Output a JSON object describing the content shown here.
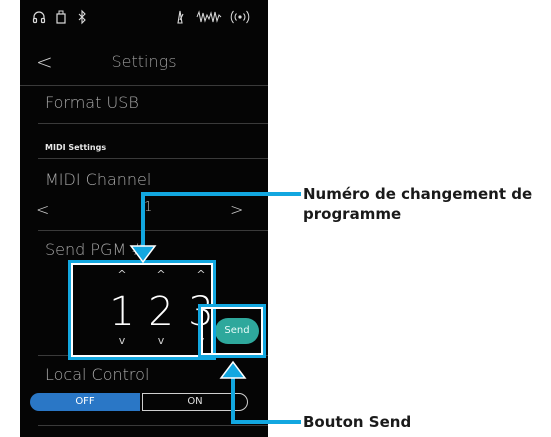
{
  "header": {
    "back_glyph": "<",
    "title": "Settings"
  },
  "rows": {
    "format_usb": "Format USB",
    "midi_section": "MIDI Settings",
    "midi_channel": "MIDI Channel",
    "midi_channel_value": "1",
    "chevron_left": "<",
    "chevron_right": ">",
    "send_pgm": "Send PGM #",
    "local_control": "Local Control"
  },
  "pgm_number": {
    "digits": [
      "1",
      "2",
      "3"
    ],
    "up_glyph": "^",
    "down_glyph": "v"
  },
  "send_button": {
    "label": "Send"
  },
  "local_control_toggle": {
    "off_label": "OFF",
    "on_label": "ON",
    "selected": "OFF"
  },
  "status_bar": {
    "icons": [
      "headphones-icon",
      "usb-drive-icon",
      "bluetooth-icon",
      "metronome-icon",
      "sound-wave-icon",
      "wireless-icon"
    ]
  },
  "callouts": {
    "program_number": "Numéro de changement de programme",
    "send_button": "Bouton Send"
  },
  "colors": {
    "accent_blue": "#12a7e0",
    "send_teal": "#2ea89c",
    "toggle_blue": "#2a77c6",
    "screen_bg": "#050505"
  }
}
